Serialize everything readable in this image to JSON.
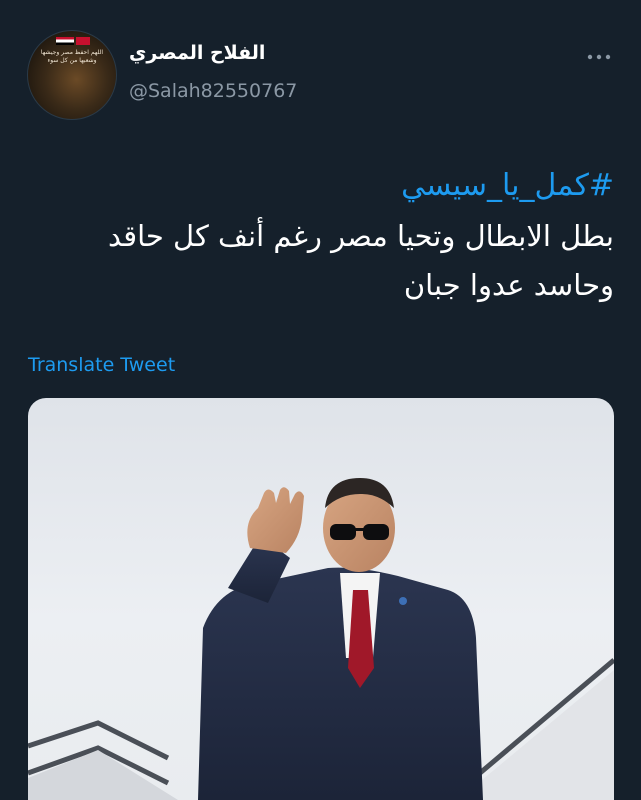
{
  "tweet": {
    "display_name": "الفلاح المصري",
    "username": "@Salah82550767",
    "hashtag": "#كمل_يا_سيسي",
    "text_line1": "بطل الابطال وتحيا مصر رغم أنف كل حاقد",
    "text_line2": "وحاسد عدوا جبان",
    "translate_label": "Translate Tweet",
    "avatar_text": "اللهم احفظ مصر وجيشها وشعبها من كل سوء",
    "more_icon": "more-horizontal-icon"
  },
  "colors": {
    "background": "#15202b",
    "accent": "#1d9bf0",
    "secondary_text": "#8b98a5"
  }
}
